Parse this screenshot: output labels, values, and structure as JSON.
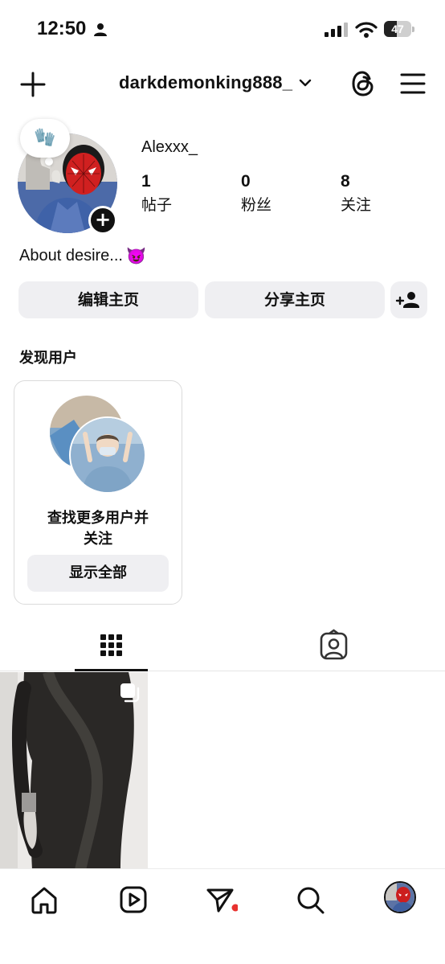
{
  "status_bar": {
    "time": "12:50",
    "battery": "47",
    "battery_level": 0.47,
    "icons": [
      "person-icon",
      "signal-icon",
      "wifi-icon",
      "battery-icon"
    ]
  },
  "header": {
    "username": "darkdemonking888_",
    "icons": [
      "plus-icon",
      "chevron-down-icon",
      "threads-icon",
      "menu-icon"
    ]
  },
  "profile": {
    "display_name": "Alexxx_",
    "note_emoji": "🧤",
    "stats": [
      {
        "value": "1",
        "label": "帖子"
      },
      {
        "value": "0",
        "label": "粉丝"
      },
      {
        "value": "8",
        "label": "关注"
      }
    ],
    "bio": "About desire...",
    "bio_emoji": "😈"
  },
  "actions": {
    "edit_label": "编辑主页",
    "share_label": "分享主页"
  },
  "discover": {
    "title": "发现用户",
    "card_text": "查找更多用户并关注",
    "card_line1": "查找更多用户并",
    "card_line2": "关注",
    "show_all_label": "显示全部"
  },
  "tabs": [
    {
      "name": "grid",
      "icon": "grid-icon",
      "active": true
    },
    {
      "name": "tagged",
      "icon": "tagged-icon",
      "active": false
    }
  ],
  "bottom_nav": [
    "home-icon",
    "reels-icon",
    "send-icon",
    "search-icon",
    "profile-avatar"
  ],
  "colors": {
    "button_bg": "#efeff2",
    "text": "#111111",
    "notification_dot": "#e8322f"
  }
}
